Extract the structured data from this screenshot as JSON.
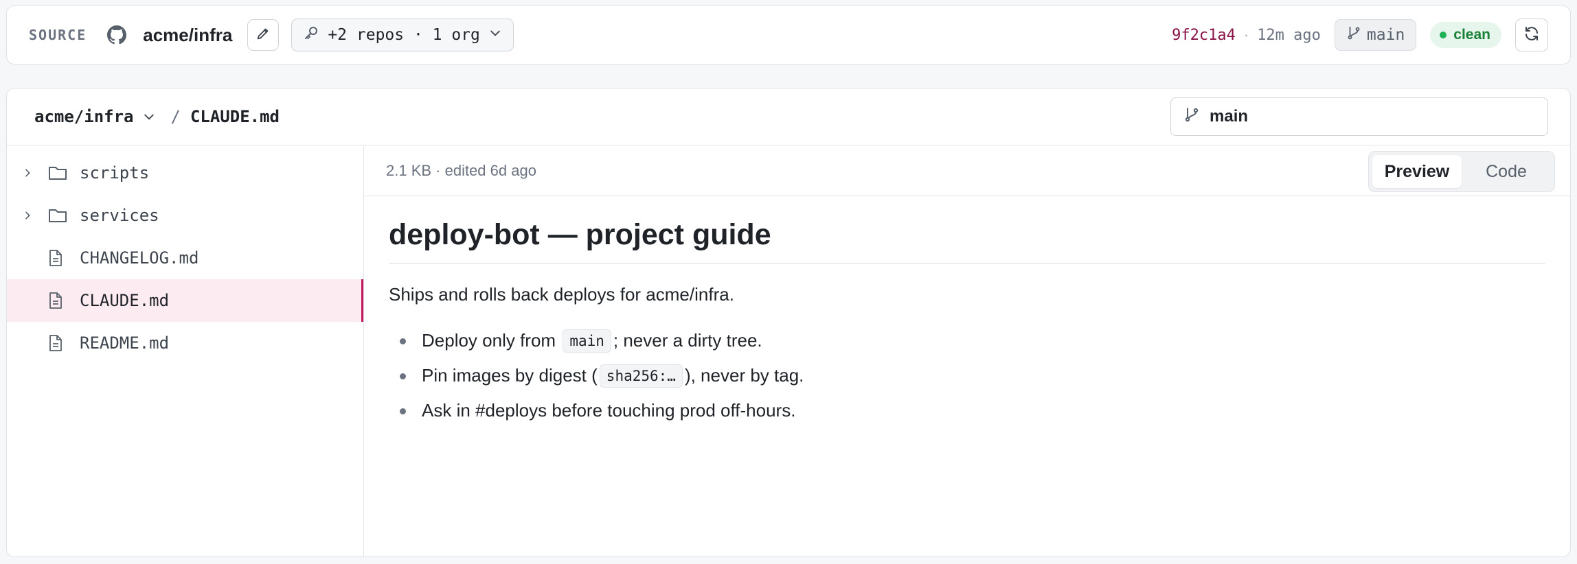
{
  "source_bar": {
    "label": "SOURCE",
    "repo": "acme/infra",
    "scope_label": "+2 repos · 1 org",
    "commit_sha": "9f2c1a4",
    "separator": "·",
    "commit_age": "12m ago",
    "branch": "main",
    "status": "clean",
    "icons": [
      "github-icon",
      "pencil-icon",
      "key-icon",
      "chevron-down-icon",
      "branch-icon",
      "refresh-icon"
    ]
  },
  "breadcrumb": {
    "repo": "acme/infra",
    "separator": "/",
    "file": "CLAUDE.md"
  },
  "branch_selector": {
    "value": "main"
  },
  "file_tree": {
    "items": [
      {
        "label": "scripts",
        "type": "folder"
      },
      {
        "label": "services",
        "type": "folder"
      },
      {
        "label": "CHANGELOG.md",
        "type": "file"
      },
      {
        "label": "CLAUDE.md",
        "type": "file",
        "selected": true
      },
      {
        "label": "README.md",
        "type": "file"
      }
    ]
  },
  "file_meta": "2.1 KB · edited 6d ago",
  "view_toggle": {
    "preview": "Preview",
    "code": "Code",
    "active": "Preview"
  },
  "document": {
    "title": "deploy-bot — project guide",
    "intro": "Ships and rolls back deploys for acme/infra.",
    "bullets": [
      {
        "before": "Deploy only from ",
        "code": "main",
        "after": "; never a dirty tree."
      },
      {
        "before": "Pin images by digest (",
        "code": "sha256:…",
        "after": "), never by tag."
      },
      {
        "text": "Ask in #deploys before touching prod off-hours."
      }
    ]
  },
  "colors": {
    "accent": "#c2185b",
    "selected_bg": "#fdebf2",
    "status_green": "#1a7f37",
    "sha": "#8a1347"
  }
}
